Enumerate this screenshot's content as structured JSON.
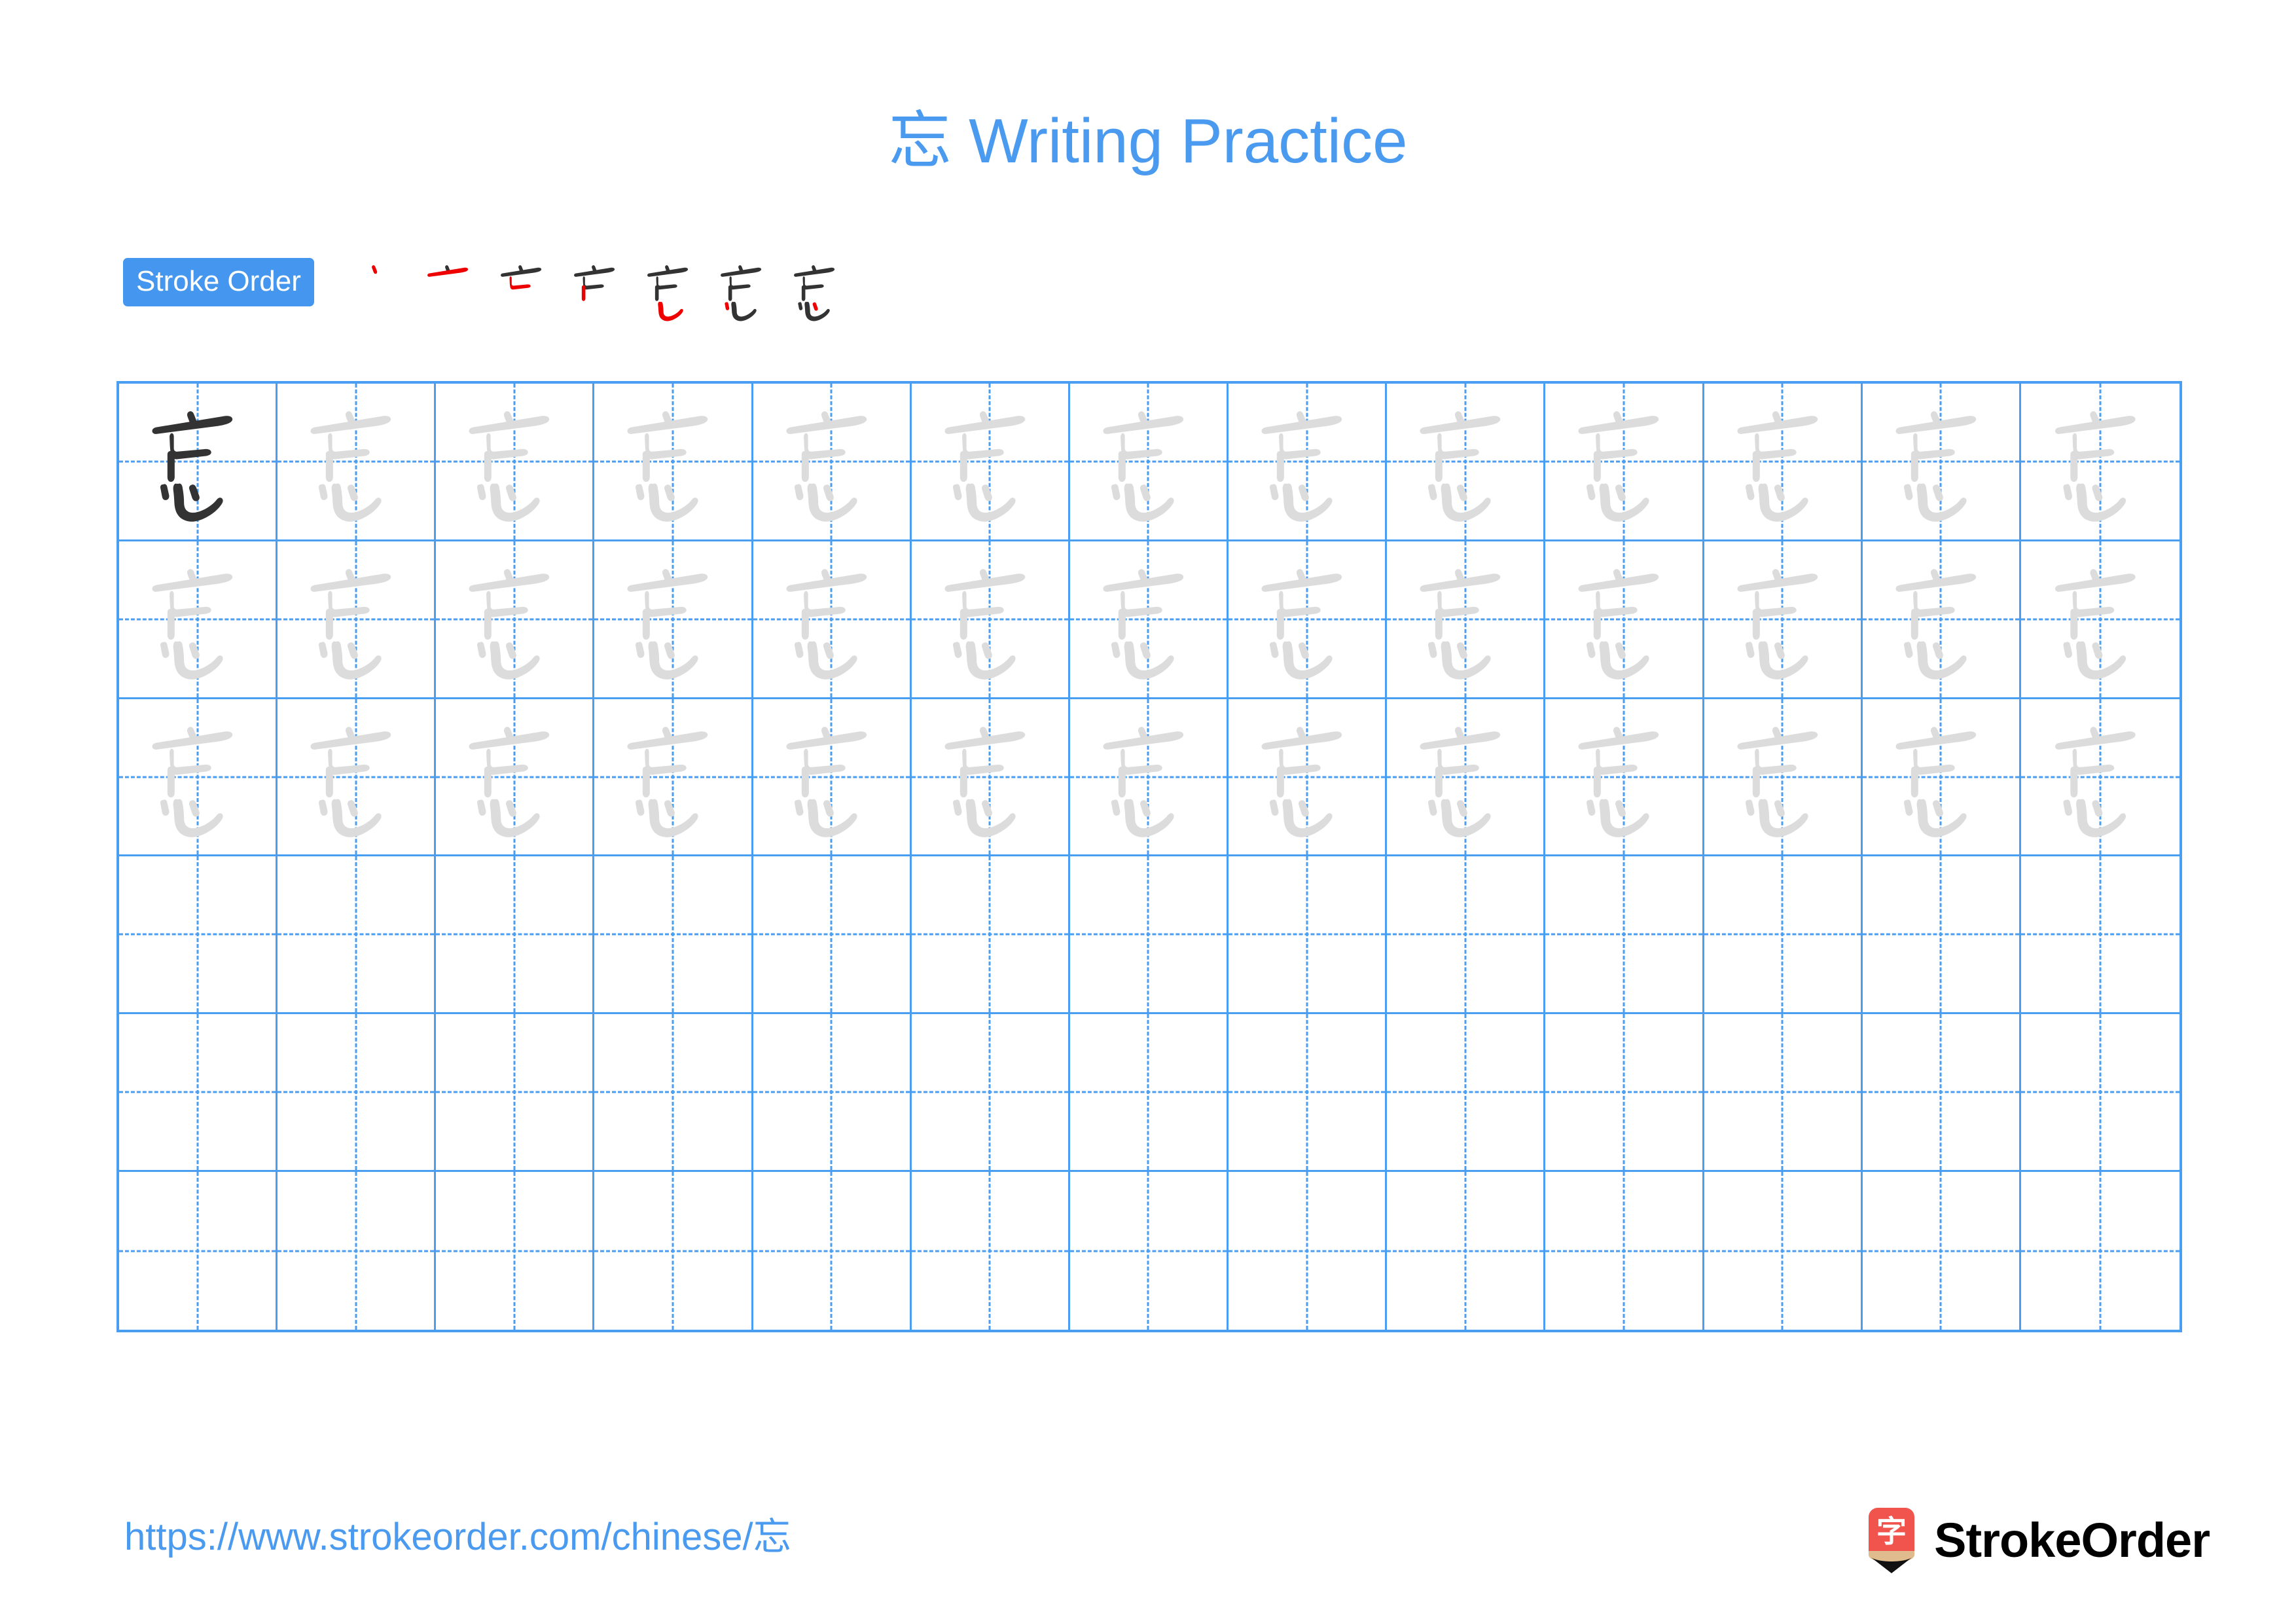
{
  "character": "忘",
  "title": "忘 Writing Practice",
  "colors": {
    "title_blue": "#4a9af0",
    "badge_blue": "#4596ee",
    "grid_blue": "#4a9ef2",
    "stroke_dark": "#333333",
    "stroke_red": "#ee0000",
    "trace_gray": "#dcdcdc",
    "logo_red": "#f0544c",
    "logo_wood": "#e0bb8e",
    "logo_tip": "#111111"
  },
  "stroke_order": {
    "badge_label": "Stroke Order",
    "total_strokes": 7,
    "steps": [
      {
        "index": 1,
        "strokes_shown": 1,
        "new_stroke": 1,
        "name": "dian"
      },
      {
        "index": 2,
        "strokes_shown": 2,
        "new_stroke": 2,
        "name": "heng"
      },
      {
        "index": 3,
        "strokes_shown": 3,
        "new_stroke": 3,
        "name": "hengzhe"
      },
      {
        "index": 4,
        "strokes_shown": 4,
        "new_stroke": 4,
        "name": "shu-gou-left"
      },
      {
        "index": 5,
        "strokes_shown": 5,
        "new_stroke": 5,
        "name": "wogou"
      },
      {
        "index": 6,
        "strokes_shown": 6,
        "new_stroke": 6,
        "name": "dian-inner"
      },
      {
        "index": 7,
        "strokes_shown": 7,
        "new_stroke": 7,
        "name": "dian-right"
      }
    ]
  },
  "grid": {
    "columns": 13,
    "rows": 6,
    "cells": [
      [
        "dark",
        "light",
        "light",
        "light",
        "light",
        "light",
        "light",
        "light",
        "light",
        "light",
        "light",
        "light",
        "light"
      ],
      [
        "light",
        "light",
        "light",
        "light",
        "light",
        "light",
        "light",
        "light",
        "light",
        "light",
        "light",
        "light",
        "light"
      ],
      [
        "light",
        "light",
        "light",
        "light",
        "light",
        "light",
        "light",
        "light",
        "light",
        "light",
        "light",
        "light",
        "light"
      ],
      [
        "empty",
        "empty",
        "empty",
        "empty",
        "empty",
        "empty",
        "empty",
        "empty",
        "empty",
        "empty",
        "empty",
        "empty",
        "empty"
      ],
      [
        "empty",
        "empty",
        "empty",
        "empty",
        "empty",
        "empty",
        "empty",
        "empty",
        "empty",
        "empty",
        "empty",
        "empty",
        "empty"
      ],
      [
        "empty",
        "empty",
        "empty",
        "empty",
        "empty",
        "empty",
        "empty",
        "empty",
        "empty",
        "empty",
        "empty",
        "empty",
        "empty"
      ]
    ]
  },
  "footer": {
    "url": "https://www.strokeorder.com/chinese/忘",
    "brand_name": "StrokeOrder",
    "brand_icon_char": "字"
  }
}
